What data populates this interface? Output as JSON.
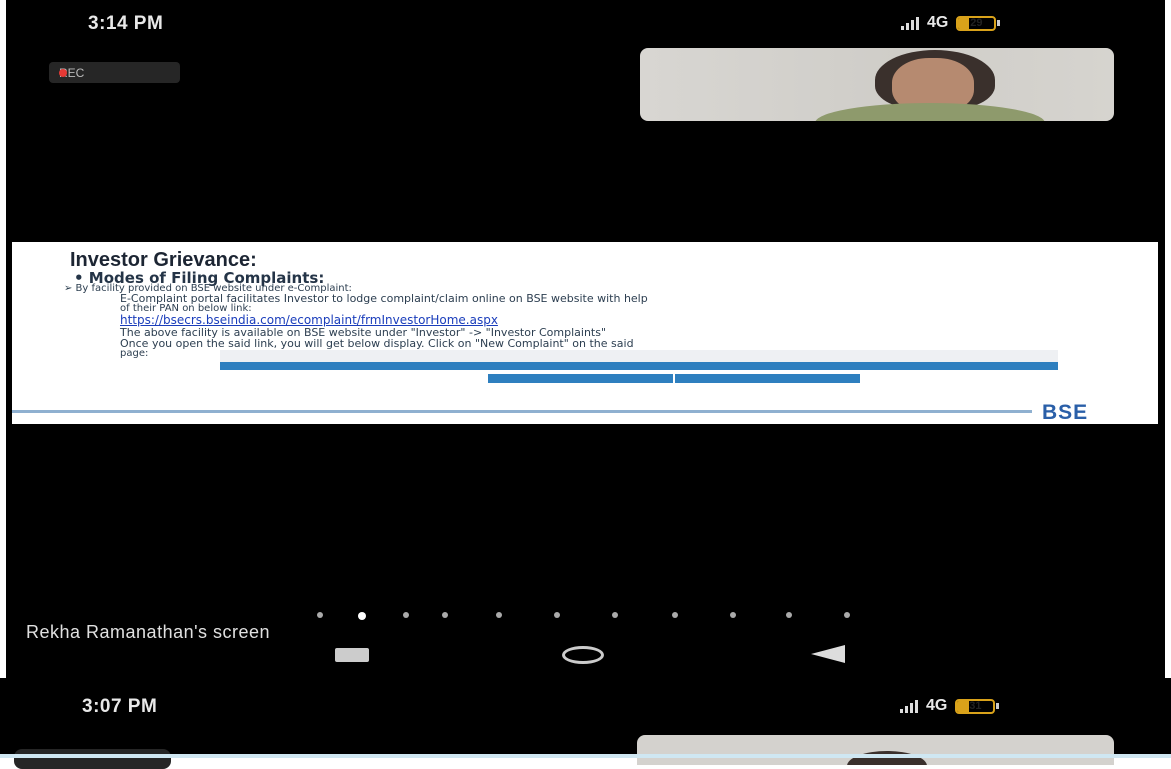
{
  "screenshot_top": {
    "status_bar": {
      "time": "3:14 PM",
      "network": "4G",
      "battery_level": "29"
    },
    "recording_badge": "REC",
    "shared_slide": {
      "title": "Investor Grievance:",
      "bullet": "• Modes of Filing Complaints:",
      "subpoint": "➢ By facility provided on BSE website under e-Complaint:",
      "body_line1": "E-Complaint portal facilitates Investor to lodge complaint/claim online on BSE website with help",
      "body_line2": "of their PAN on below link:",
      "link": "https://bsecrs.bseindia.com/ecomplaint/frmInvestorHome.aspx",
      "body_line3": "The above facility is available on BSE website under \"Investor\" -> \"Investor Complaints\"",
      "body_line4": "Once you open the said link, you will get below display. Click on \"New Complaint\" on the said",
      "body_line5": "page:",
      "logo": "BSE"
    },
    "page_indicator": {
      "count": 10,
      "active_index": 1
    },
    "screen_caption": "Rekha Ramanathan's screen"
  },
  "screenshot_bottom": {
    "status_bar": {
      "time": "3:07 PM",
      "network": "4G",
      "battery_level": "31"
    }
  },
  "colors": {
    "background": "#000000",
    "link": "#1a3dbb",
    "portal_blue": "#2e7fbf",
    "rec_dot": "#e53935",
    "battery": "#d9a21a"
  }
}
